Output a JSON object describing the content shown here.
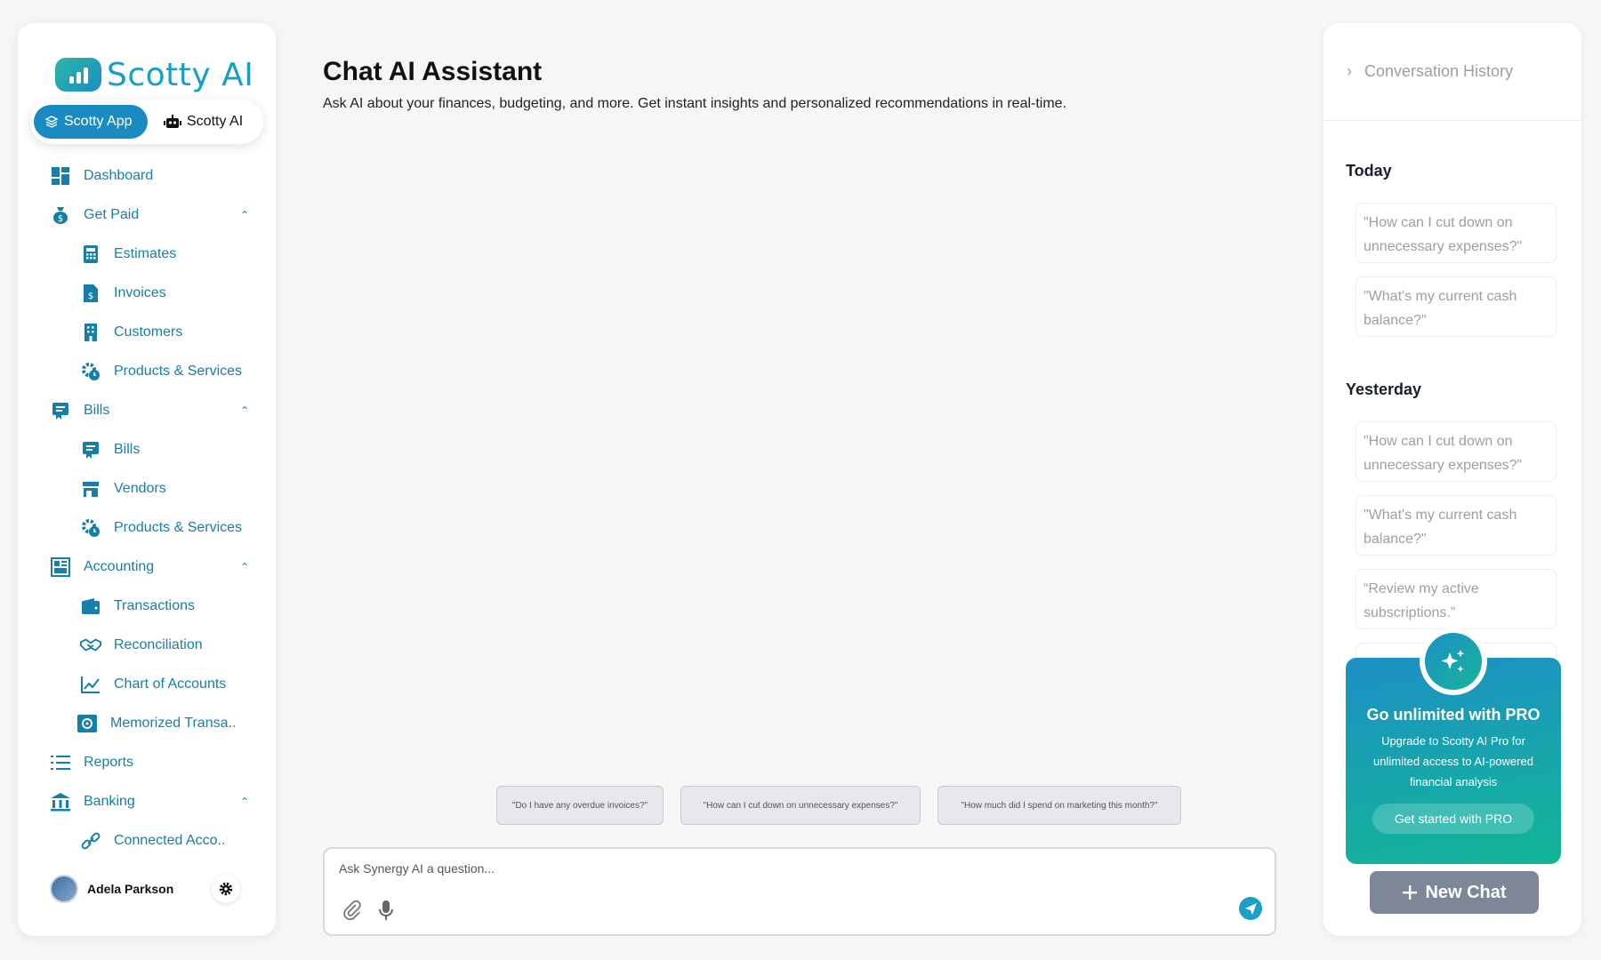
{
  "brand": {
    "name": "Scotty AI"
  },
  "switcher": {
    "app_label": "Scotty App",
    "ai_label": "Scotty AI"
  },
  "nav": {
    "dashboard": "Dashboard",
    "get_paid": "Get Paid",
    "estimates": "Estimates",
    "invoices": "Invoices",
    "customers": "Customers",
    "products_services_1": "Products & Services",
    "bills_group": "Bills",
    "bills": "Bills",
    "vendors": "Vendors",
    "products_services_2": "Products & Services",
    "accounting": "Accounting",
    "transactions": "Transactions",
    "reconciliation": "Reconciliation",
    "chart_of_accounts": "Chart of Accounts",
    "memorized": "Memorized Transa..",
    "reports": "Reports",
    "banking": "Banking",
    "connected": "Connected Acco.."
  },
  "user": {
    "name": "Adela Parkson"
  },
  "main": {
    "title": "Chat AI Assistant",
    "subtitle": "Ask AI about your finances, budgeting, and more. Get instant insights and personalized recommendations in real-time.",
    "suggestions": [
      "\"Do I have any overdue invoices?\"",
      "\"How can I cut down on unnecessary expenses?\"",
      "\"How much did I spend on marketing this month?\""
    ],
    "input_placeholder": "Ask Synergy AI a question..."
  },
  "history": {
    "title": "Conversation History",
    "today_label": "Today",
    "yesterday_label": "Yesterday",
    "today": [
      "\"How can I cut down on unnecessary expenses?\"",
      "\"What's my current cash balance?\""
    ],
    "yesterday": [
      "\"How can I cut down on unnecessary expenses?\"",
      "\"What's my current cash balance?\"",
      "“Review my active subscriptions.”"
    ]
  },
  "pro": {
    "title": "Go unlimited with PRO",
    "text": "Upgrade to Scotty AI Pro for unlimited access to AI-powered financial analysis",
    "button": "Get started with PRO"
  },
  "new_chat_label": "New Chat",
  "colors": {
    "accent": "#1a8bc2",
    "nav_text": "#177ea8",
    "pro_gradient_start": "#1d8fc6",
    "pro_gradient_end": "#12b596",
    "new_chat_bg": "#7d8799"
  }
}
